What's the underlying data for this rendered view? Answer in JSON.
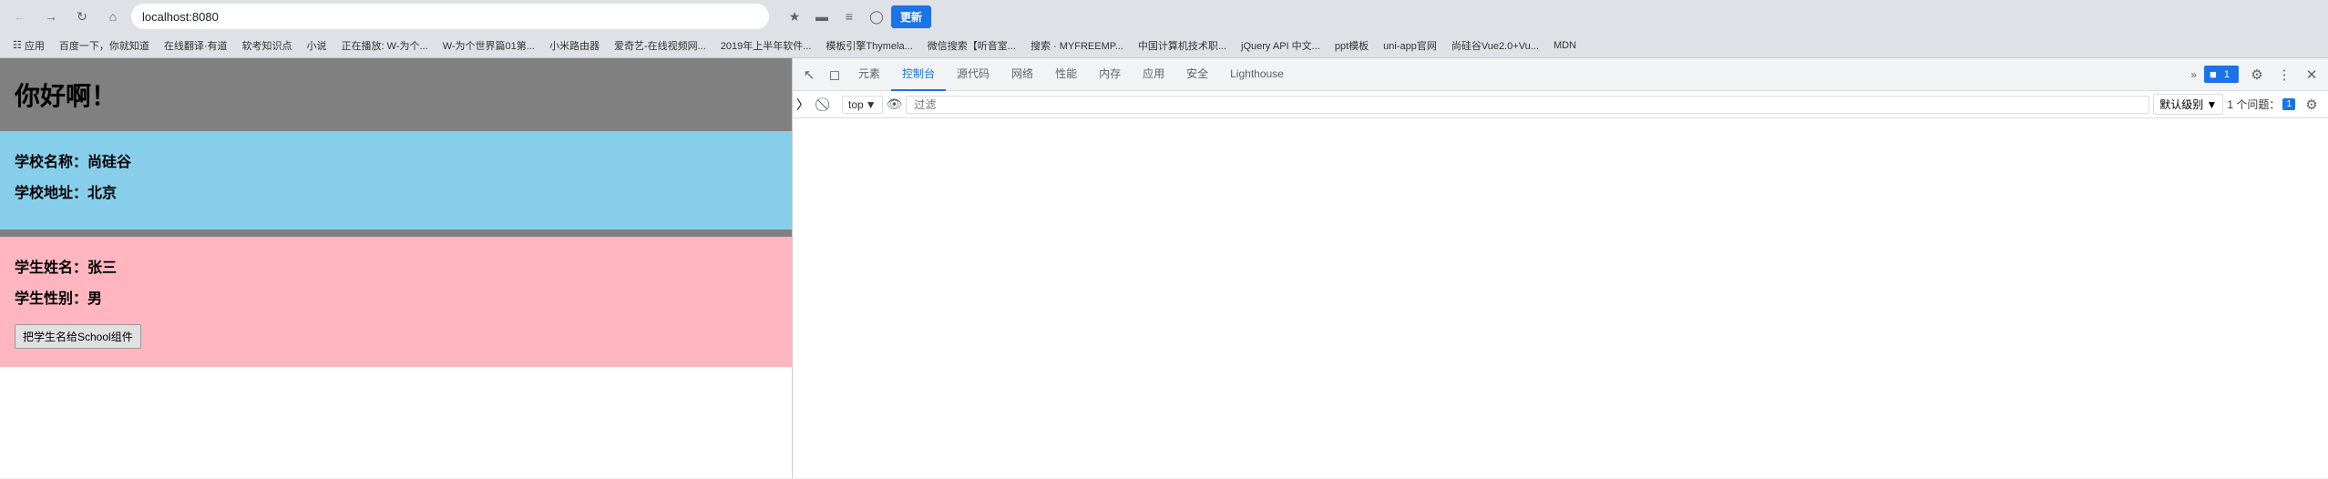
{
  "browser": {
    "url": "localhost:8080",
    "nav": {
      "back": "←",
      "forward": "→",
      "refresh": "↻",
      "home": "⌂"
    },
    "bookmarks": [
      {
        "label": "应用"
      },
      {
        "label": "百度一下，你就知道"
      },
      {
        "label": "在线翻译·有道"
      },
      {
        "label": "软考知识点"
      },
      {
        "label": "小说"
      },
      {
        "label": "正在播放: W-为个..."
      },
      {
        "label": "W-为个世界篇01第..."
      },
      {
        "label": "小米路由器"
      },
      {
        "label": "爱奇艺-在线视频网..."
      },
      {
        "label": "2019年上半年软件..."
      },
      {
        "label": "模板引擎Thymela..."
      },
      {
        "label": "微信搜索【听音室..."
      },
      {
        "label": "搜索 · MYFREEMP..."
      },
      {
        "label": "中国计算机技术职..."
      },
      {
        "label": "jQuery API 中文..."
      },
      {
        "label": "ppt模板"
      },
      {
        "label": "uni-app官网"
      },
      {
        "label": "尚硅谷Vue2.0+Vu..."
      },
      {
        "label": "MDN"
      }
    ],
    "update_btn": "更新"
  },
  "webpage": {
    "greeting": "你好啊！",
    "school_name_label": "学校名称：",
    "school_name_value": "尚硅谷",
    "school_address_label": "学校地址：",
    "school_address_value": "北京",
    "student_name_label": "学生姓名：",
    "student_name_value": "张三",
    "student_gender_label": "学生性别：",
    "student_gender_value": "男",
    "button_label": "把学生名给School组件"
  },
  "devtools": {
    "tabs": [
      {
        "label": "元素",
        "active": false
      },
      {
        "label": "控制台",
        "active": true
      },
      {
        "label": "源代码",
        "active": false
      },
      {
        "label": "网络",
        "active": false
      },
      {
        "label": "性能",
        "active": false
      },
      {
        "label": "内存",
        "active": false
      },
      {
        "label": "应用",
        "active": false
      },
      {
        "label": "安全",
        "active": false
      },
      {
        "label": "Lighthouse",
        "active": false
      }
    ],
    "more_tabs": "»",
    "badge_count": "1",
    "badge_issues": "1",
    "console_bar": {
      "top_label": "top",
      "eye_icon": "👁",
      "filter_placeholder": "过滤",
      "level_label": "默认级别 ▼",
      "issue_label": "1 个问题：",
      "issue_count": "1"
    },
    "icons": {
      "inspect": "⬚",
      "device": "□",
      "cursor": "↖",
      "ban": "⊘",
      "settings": "⚙",
      "dots": "⋮",
      "close": "✕",
      "console_settings": "⚙"
    }
  }
}
